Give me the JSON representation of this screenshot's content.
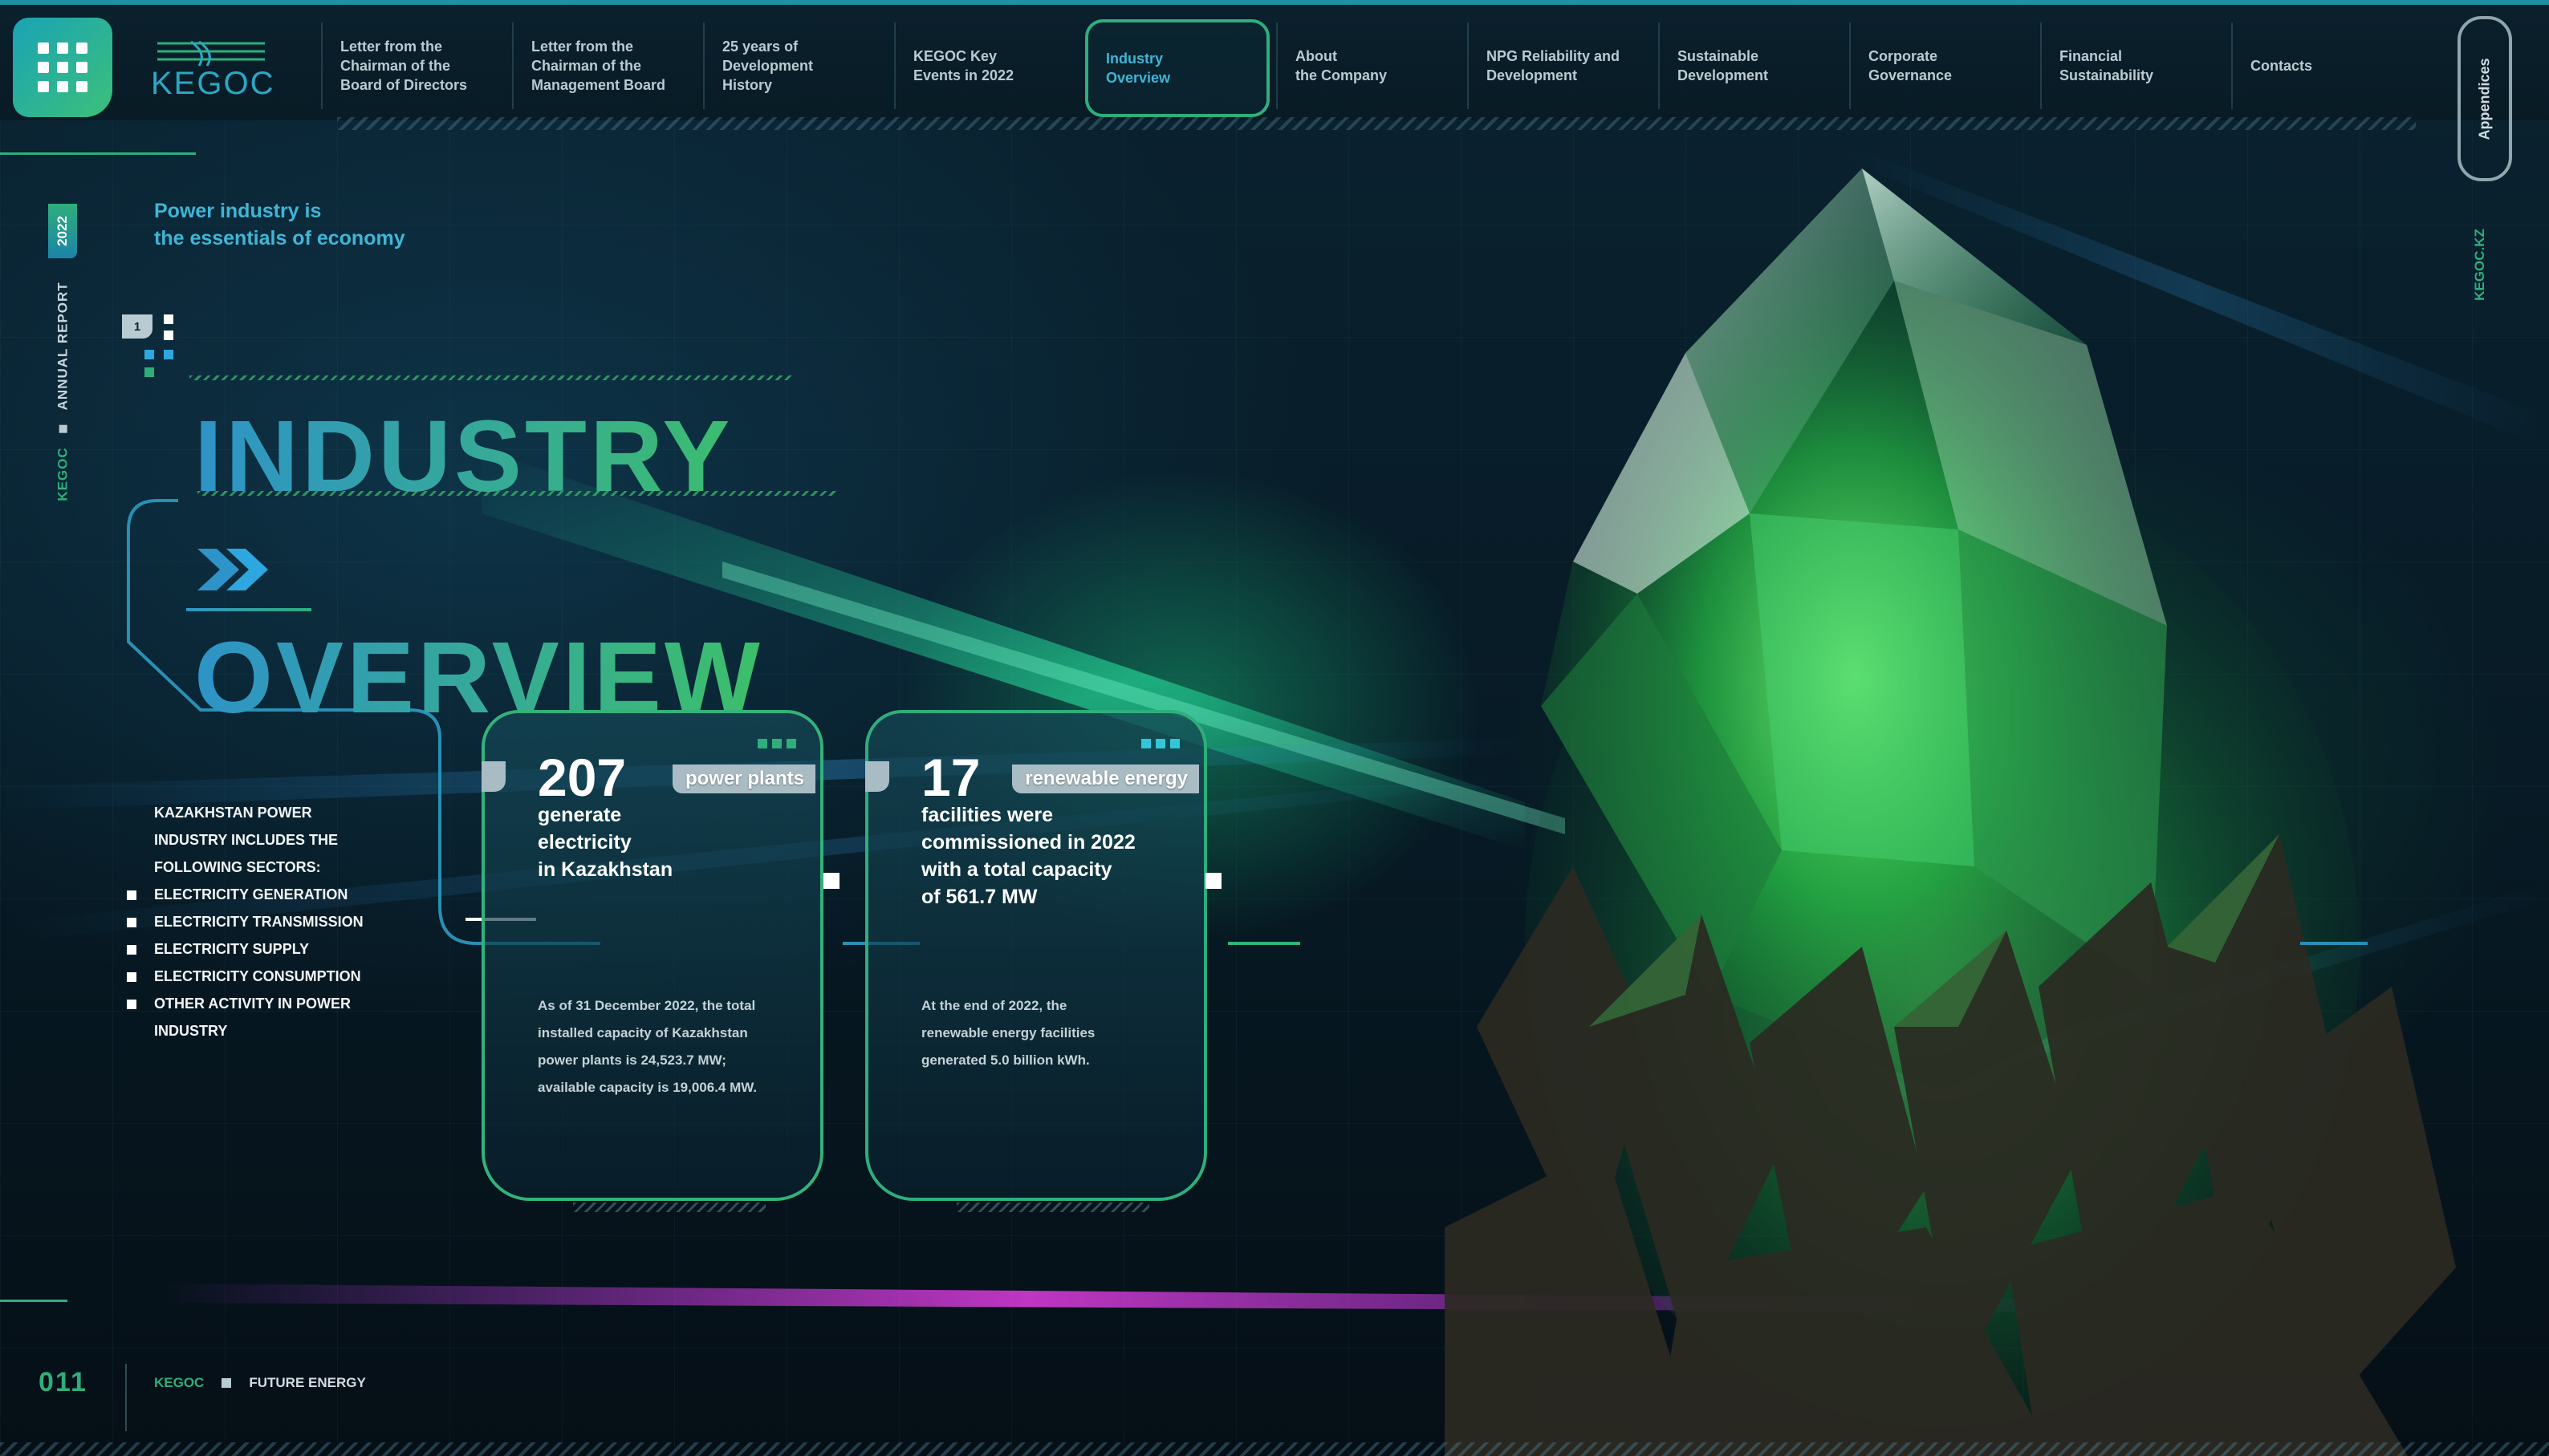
{
  "brand": {
    "logo_text": "KEGOC"
  },
  "nav": {
    "items": [
      {
        "label": "Letter from the\nChairman of the\nBoard of Directors",
        "active": false
      },
      {
        "label": "Letter from the\nChairman of the\nManagement Board",
        "active": false
      },
      {
        "label": "25 years of\nDevelopment\nHistory",
        "active": false
      },
      {
        "label": "KEGOC Key\nEvents in 2022",
        "active": false
      },
      {
        "label": "Industry\nOverview",
        "active": true
      },
      {
        "label": "About\nthe Company",
        "active": false
      },
      {
        "label": "NPG Reliability and\nDevelopment",
        "active": false
      },
      {
        "label": "Sustainable\nDevelopment",
        "active": false
      },
      {
        "label": "Corporate\nGovernance",
        "active": false
      },
      {
        "label": "Financial\nSustainability",
        "active": false
      },
      {
        "label": "Contacts",
        "active": false
      }
    ],
    "appendices_label": "Appendices",
    "site_label": "KEGOC.KZ"
  },
  "rail": {
    "year": "2022",
    "kegoc": "KEGOC",
    "annual_report": "ANNUAL REPORT"
  },
  "header": {
    "tagline": "Power industry is\nthe essentials of economy",
    "section_number": "1",
    "title_line1": "INDUSTRY",
    "title_line2": "OVERVIEW"
  },
  "sectors": {
    "intro": "KAZAKHSTAN POWER\nINDUSTRY INCLUDES THE\nFOLLOWING SECTORS:",
    "items": [
      "ELECTRICITY GENERATION",
      "ELECTRICITY TRANSMISSION",
      "ELECTRICITY SUPPLY",
      "ELECTRICITY CONSUMPTION",
      "OTHER ACTIVITY IN POWER INDUSTRY"
    ]
  },
  "cards": [
    {
      "value": "207",
      "tag": "power plants",
      "description": "generate\nelectricity\nin Kazakhstan",
      "note": "As of 31 December 2022, the total\ninstalled capacity of Kazakhstan\npower plants is 24,523.7 MW;\navailable capacity is 19,006.4 MW."
    },
    {
      "value": "17",
      "tag": "renewable energy",
      "description": "facilities were\ncommissioned in 2022\nwith a total capacity\nof 561.7 MW",
      "note": "At the end of 2022, the\nrenewable energy facilities\ngenerated 5.0 billion kWh."
    }
  ],
  "footer": {
    "page_number": "011",
    "kegoc": "KEGOC",
    "tagline": "FUTURE ENERGY"
  },
  "colors": {
    "accent_green": "#2fae7c",
    "accent_blue": "#3fb6d6",
    "background": "#06141d"
  },
  "icons": {
    "menu": "grid-menu-icon",
    "chevrons": "double-chevron-right-icon"
  }
}
